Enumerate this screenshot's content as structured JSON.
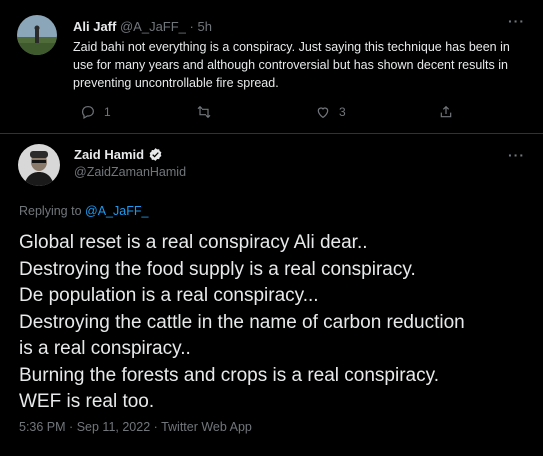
{
  "reply_tweet": {
    "author_name": "Ali Jaff",
    "author_handle": "@A_JaFF_",
    "separator": "·",
    "time": "5h",
    "text": "Zaid bahi not everything is a conspiracy. Just saying this technique has been in use for many years and although controversial but has shown decent results in preventing uncontrollable fire spread.",
    "more_label": "···",
    "actions": {
      "reply": {
        "icon": "reply-icon",
        "count": "1"
      },
      "retweet": {
        "icon": "retweet-icon",
        "count": ""
      },
      "like": {
        "icon": "heart-icon",
        "count": "3"
      },
      "share": {
        "icon": "share-icon",
        "count": ""
      }
    }
  },
  "main_tweet": {
    "author_name": "Zaid Hamid",
    "author_handle": "@ZaidZamanHamid",
    "verified": true,
    "more_label": "···",
    "replying_prefix": "Replying to",
    "replying_to": "@A_JaFF_",
    "text_lines": [
      "Global reset is a real conspiracy Ali dear..",
      "Destroying the food supply is a real conspiracy.",
      "De population is a real conspiracy...",
      "Destroying the cattle in the name of carbon reduction",
      "is a real conspiracy..",
      "Burning the forests and crops is a real conspiracy.",
      "WEF is real too."
    ],
    "time": "5:36 PM",
    "separator1": "·",
    "date": "Sep 11, 2022",
    "separator2": "·",
    "source": "Twitter Web App"
  },
  "colors": {
    "background": "#000000",
    "text": "#e7e9ea",
    "muted": "#71767b",
    "link": "#1d9bf0",
    "divider": "#2f3336"
  }
}
